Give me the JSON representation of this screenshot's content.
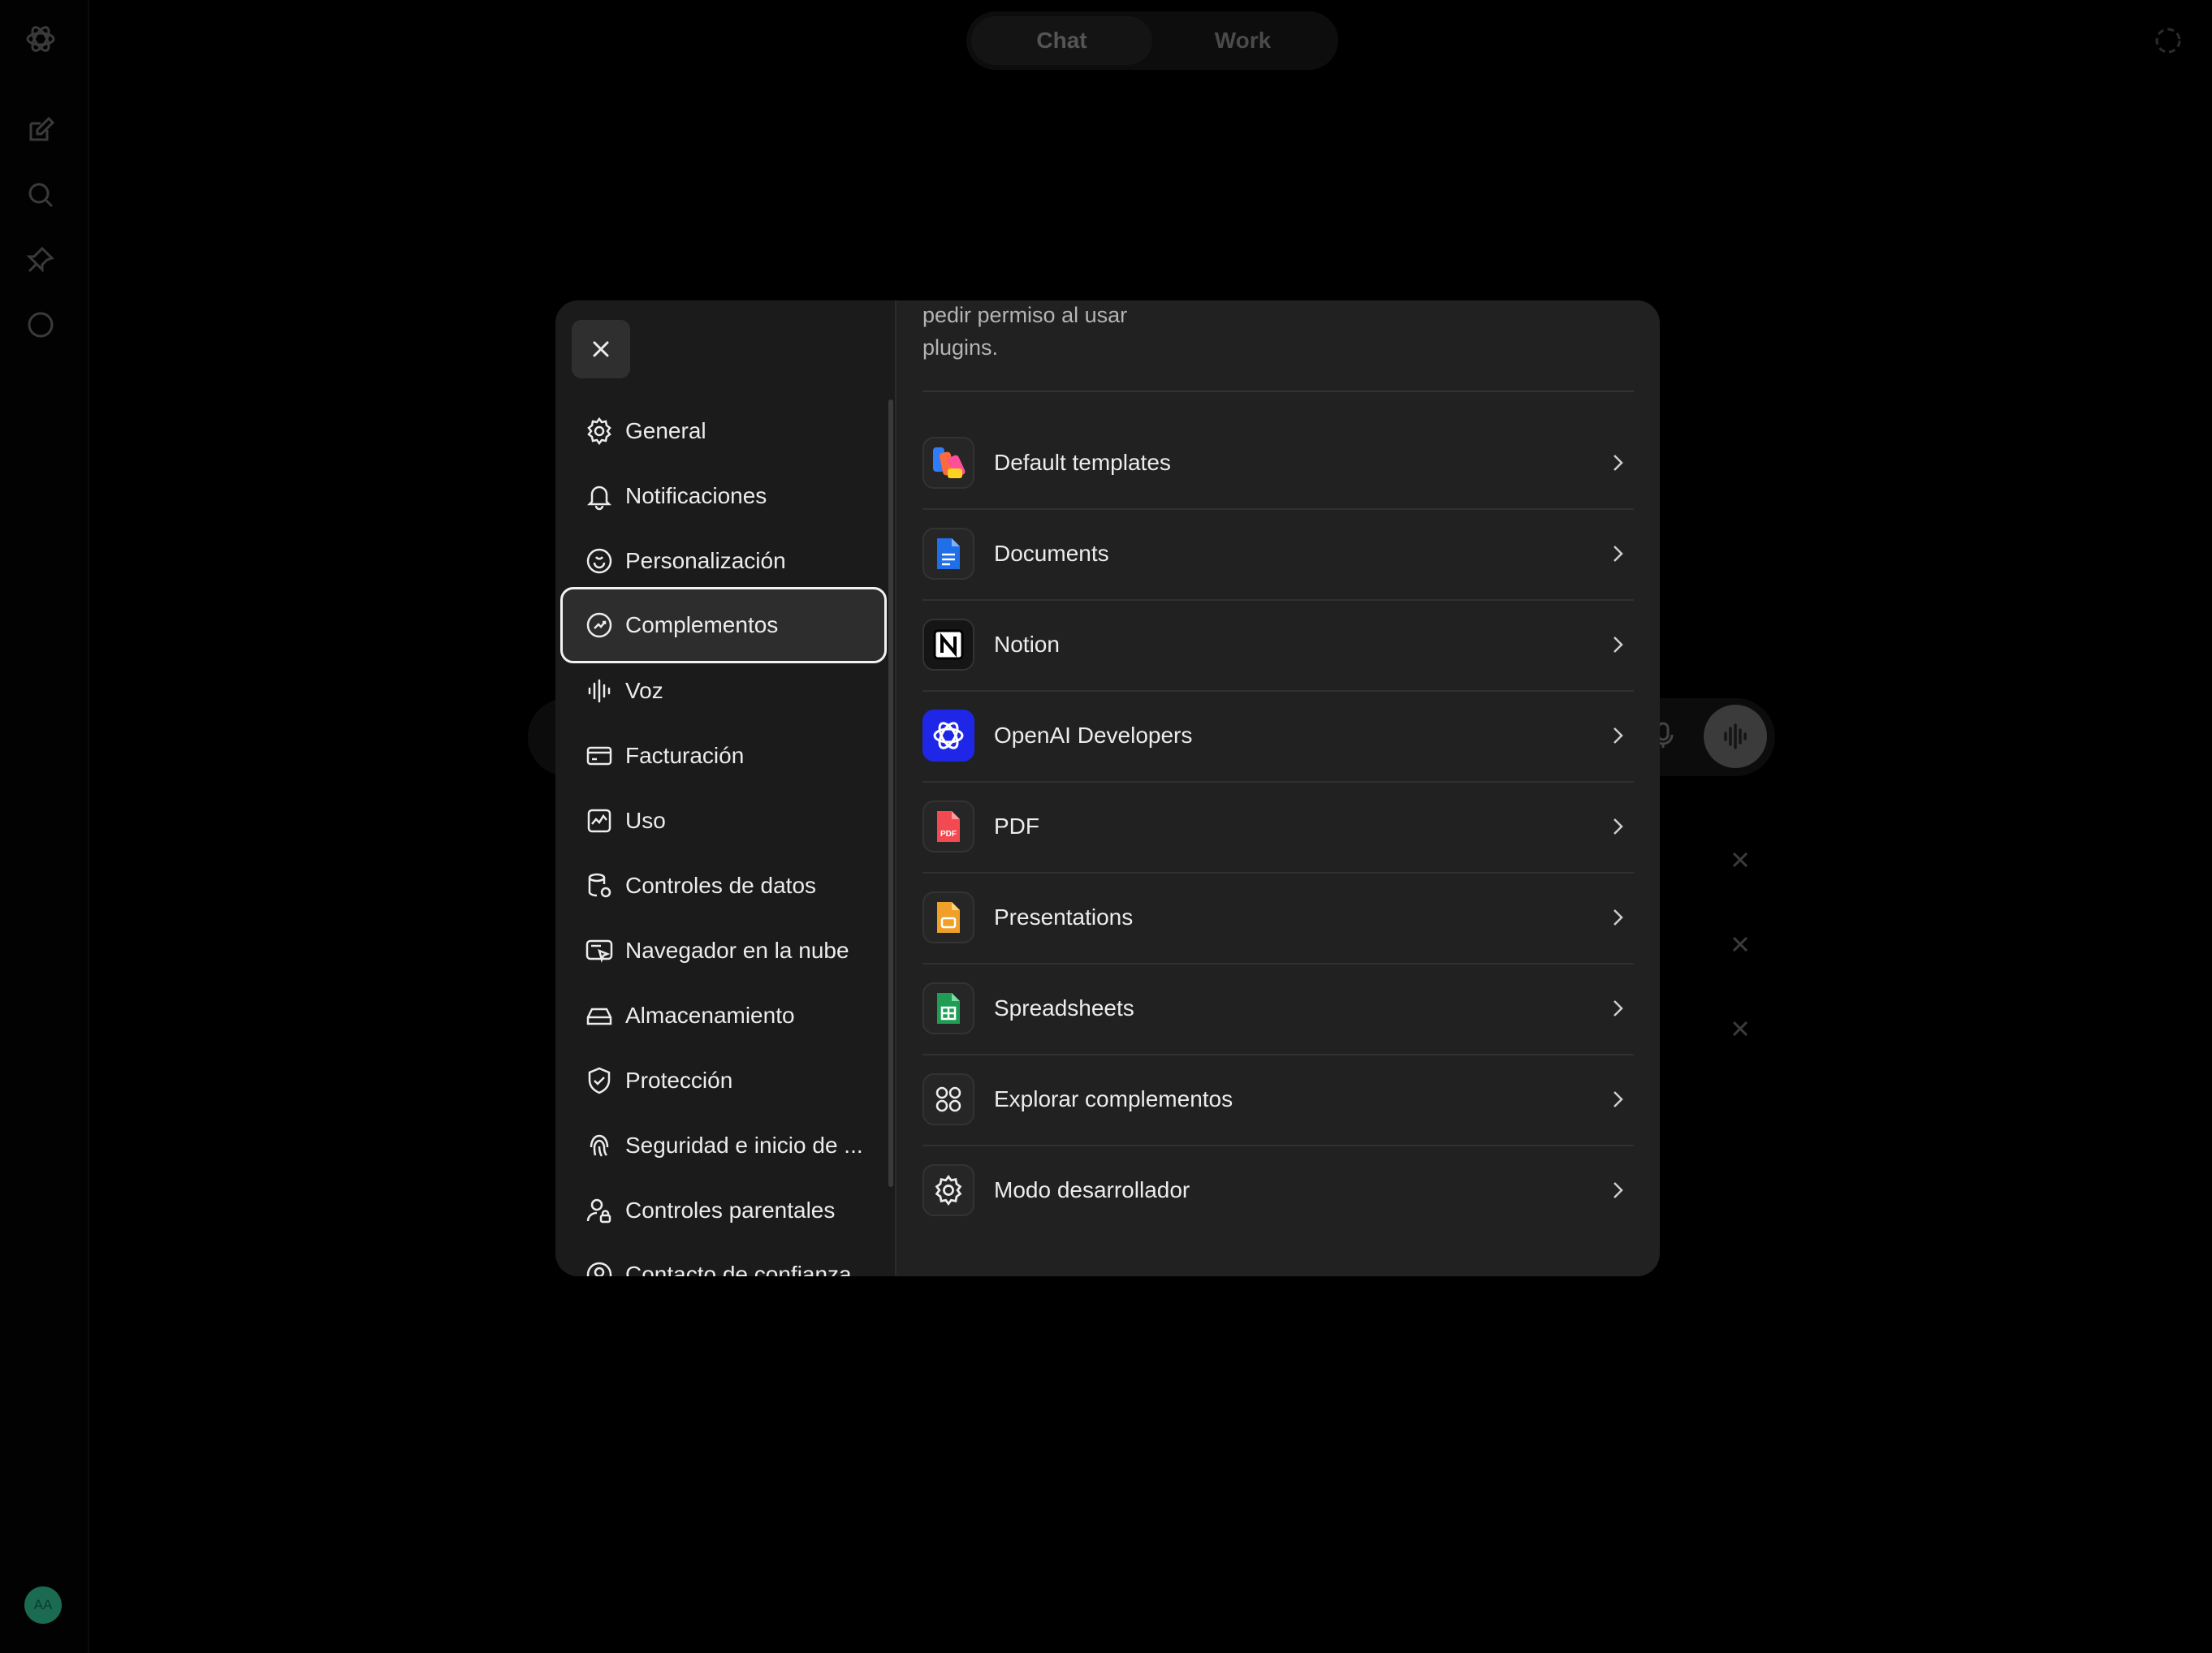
{
  "topbar": {
    "modes": [
      {
        "label": "Chat",
        "active": true
      },
      {
        "label": "Work",
        "active": false
      }
    ]
  },
  "rail": {
    "icons": [
      "openai-logo-icon",
      "new-chat-icon",
      "search-icon",
      "pin-icon",
      "chat-bubble-icon"
    ],
    "avatar_initials": "AA"
  },
  "settings": {
    "close_icon": "close-icon",
    "nav": [
      {
        "label": "General",
        "icon": "gear-icon",
        "active": false
      },
      {
        "label": "Notificaciones",
        "icon": "bell-icon",
        "active": false
      },
      {
        "label": "Personalización",
        "icon": "personalization-icon",
        "active": false
      },
      {
        "label": "Complementos",
        "icon": "plugins-icon",
        "active": true
      },
      {
        "label": "Voz",
        "icon": "voice-wave-icon",
        "active": false
      },
      {
        "label": "Facturación",
        "icon": "credit-card-icon",
        "active": false
      },
      {
        "label": "Uso",
        "icon": "usage-chart-icon",
        "active": false
      },
      {
        "label": "Controles de datos",
        "icon": "database-gear-icon",
        "active": false
      },
      {
        "label": "Navegador en la nube",
        "icon": "cloud-browser-icon",
        "active": false
      },
      {
        "label": "Almacenamiento",
        "icon": "storage-drive-icon",
        "active": false
      },
      {
        "label": "Protección",
        "icon": "shield-check-icon",
        "active": false
      },
      {
        "label": "Seguridad e inicio de ...",
        "icon": "fingerprint-icon",
        "active": false
      },
      {
        "label": "Controles parentales",
        "icon": "parent-user-icon",
        "active": false
      },
      {
        "label": "Contacto de confianza",
        "icon": "trusted-contact-icon",
        "active": false
      }
    ],
    "description": "pedir permiso al usar plugins.",
    "plugins": [
      {
        "name": "Default templates",
        "icon": "templates-icon"
      },
      {
        "name": "Documents",
        "icon": "documents-icon"
      },
      {
        "name": "Notion",
        "icon": "notion-icon"
      },
      {
        "name": "OpenAI Developers",
        "icon": "openai-developers-icon"
      },
      {
        "name": "PDF",
        "icon": "pdf-icon",
        "badge": "PDF"
      },
      {
        "name": "Presentations",
        "icon": "presentations-icon"
      },
      {
        "name": "Spreadsheets",
        "icon": "spreadsheets-icon"
      },
      {
        "name": "Explorar complementos",
        "icon": "grid-apps-icon"
      },
      {
        "name": "Modo desarrollador",
        "icon": "gear-icon"
      }
    ]
  },
  "colors": {
    "background": "#000000",
    "modal": "#212121",
    "sidebar": "#1b1b1b",
    "active_outline": "#f2f2f2",
    "text": "#ececec",
    "muted": "#b4b4b4"
  }
}
